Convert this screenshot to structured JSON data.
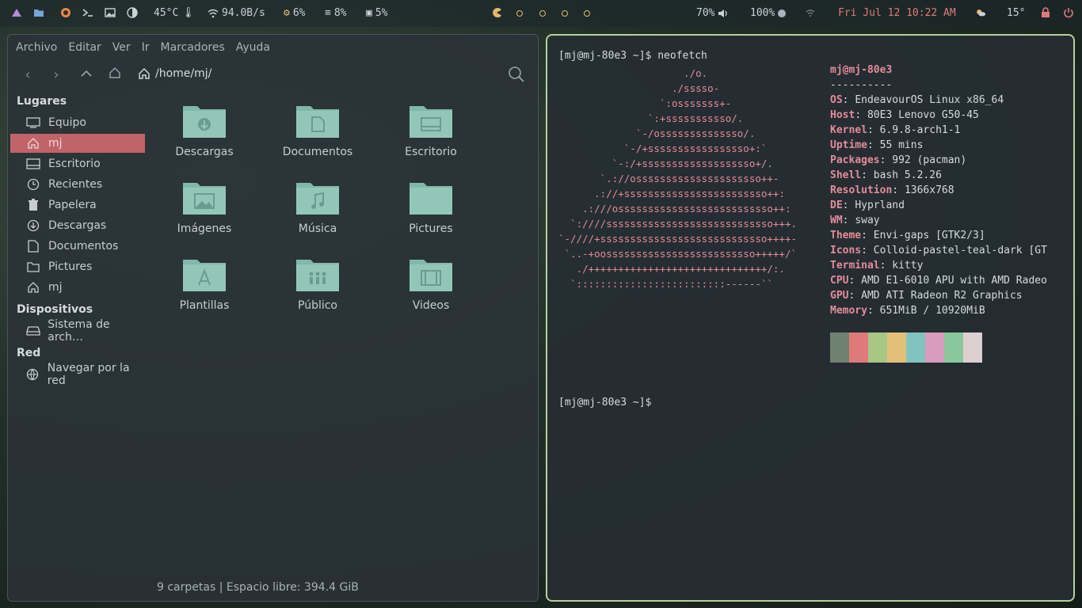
{
  "topbar": {
    "temperature": "45°C",
    "network_speed": "94.0B/s",
    "cpu": "6%",
    "memory": "8%",
    "disk": "5%",
    "volume": "70%",
    "battery": "100%",
    "datetime": "Fri Jul 12 10:22 AM",
    "weather_temp": "15°",
    "accent_date_color": "#e07a7a"
  },
  "file_manager": {
    "menu": [
      "Archivo",
      "Editar",
      "Ver",
      "Ir",
      "Marcadores",
      "Ayuda"
    ],
    "path": "/home/mj/",
    "sidebar": {
      "places_heading": "Lugares",
      "places": [
        "Equipo",
        "mj",
        "Escritorio",
        "Recientes",
        "Papelera",
        "Descargas",
        "Documentos",
        "Pictures",
        "mj"
      ],
      "devices_heading": "Dispositivos",
      "devices": [
        "Sistema de arch…"
      ],
      "network_heading": "Red",
      "network": [
        "Navegar por la red"
      ]
    },
    "folders": [
      "Descargas",
      "Documentos",
      "Escritorio",
      "Imágenes",
      "Música",
      "Pictures",
      "Plantillas",
      "Público",
      "Videos"
    ],
    "status": "9 carpetas | Espacio libre: 394.4 GiB"
  },
  "terminal": {
    "prompt": "[mj@mj-80e3 ~]$",
    "command": "neofetch",
    "user_host": "mj@mj-80e3",
    "separator": "----------",
    "info": [
      {
        "key": "OS",
        "value": "EndeavourOS Linux x86_64"
      },
      {
        "key": "Host",
        "value": "80E3 Lenovo G50-45"
      },
      {
        "key": "Kernel",
        "value": "6.9.8-arch1-1"
      },
      {
        "key": "Uptime",
        "value": "55 mins"
      },
      {
        "key": "Packages",
        "value": "992 (pacman)"
      },
      {
        "key": "Shell",
        "value": "bash 5.2.26"
      },
      {
        "key": "Resolution",
        "value": "1366x768"
      },
      {
        "key": "DE",
        "value": "Hyprland"
      },
      {
        "key": "WM",
        "value": "sway"
      },
      {
        "key": "Theme",
        "value": "Envi-gaps [GTK2/3]"
      },
      {
        "key": "Icons",
        "value": "Colloid-pastel-teal-dark [GT"
      },
      {
        "key": "Terminal",
        "value": "kitty"
      },
      {
        "key": "CPU",
        "value": "AMD E1-6010 APU with AMD Radeo"
      },
      {
        "key": "GPU",
        "value": "AMD ATI Radeon R2 Graphics"
      },
      {
        "key": "Memory",
        "value": "651MiB / 10920MiB"
      }
    ],
    "logo_lines": [
      "                     ./o.",
      "                   ./sssso-",
      "                 `:osssssss+-",
      "               `:+sssssssssso/.",
      "             `-/ossssssssssssso/.",
      "           `-/+sssssssssssssssso+:`",
      "         `-:/+sssssssssssssssssso+/.",
      "       `.://osssssssssssssssssssso++-",
      "      .://+ssssssssssssssssssssssso++:",
      "    .:///ossssssssssssssssssssssssso++:",
      "  `:////ssssssssssssssssssssssssssso+++.",
      "`-////+ssssssssssssssssssssssssssso++++-",
      " `..-+oosssssssssssssssssssssssso+++++/`",
      "   ./++++++++++++++++++++++++++++++/:.",
      "  `:::::::::::::::::::::::::------``"
    ],
    "palette": [
      "#6f8271",
      "#e07a7a",
      "#a8c686",
      "#e3c07a",
      "#82c2bf",
      "#d99cbf",
      "#8ac79c",
      "#dcd0d0"
    ]
  }
}
